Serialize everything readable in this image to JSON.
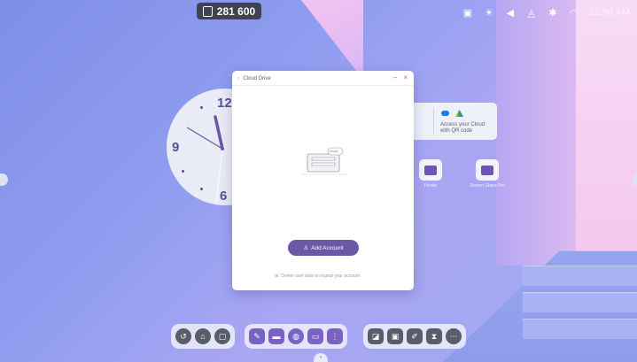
{
  "topbar": {
    "badge_icon": "screen-share-icon",
    "code": "281 600"
  },
  "status": {
    "time": "11:50 AM",
    "icons": [
      "display-icon",
      "brightness-icon",
      "volume-icon",
      "network-icon",
      "bluetooth-icon",
      "wifi-icon"
    ]
  },
  "clock": {
    "numerals": {
      "twelve": "12",
      "nine": "9",
      "six": "6"
    }
  },
  "cloud_widget": {
    "left_fragment": "d",
    "line1": "Access your Cloud",
    "line2": "with QR code"
  },
  "apps": [
    {
      "label": "Finder",
      "icon": "folder-icon"
    },
    {
      "label": "Screen Share Pro",
      "icon": "screen-share-pro-icon"
    }
  ],
  "dialog": {
    "title": "Cloud Drive",
    "empty_badge": "empty",
    "add_button": "Add Account",
    "delete_note": "Delete user data on logout your account"
  },
  "dock": {
    "group1": [
      "back-icon",
      "home-icon",
      "window-icon"
    ],
    "group2": [
      "whiteboard-icon",
      "folder-icon",
      "browser-icon",
      "cast-icon",
      "apps-grid-icon"
    ],
    "group3": [
      "split-icon",
      "screen-icon",
      "pen-icon",
      "timer-icon",
      "more-icon"
    ]
  },
  "colors": {
    "accent": "#6b58a6",
    "dock_dark": "#595d6a",
    "close": "#e0605a"
  }
}
